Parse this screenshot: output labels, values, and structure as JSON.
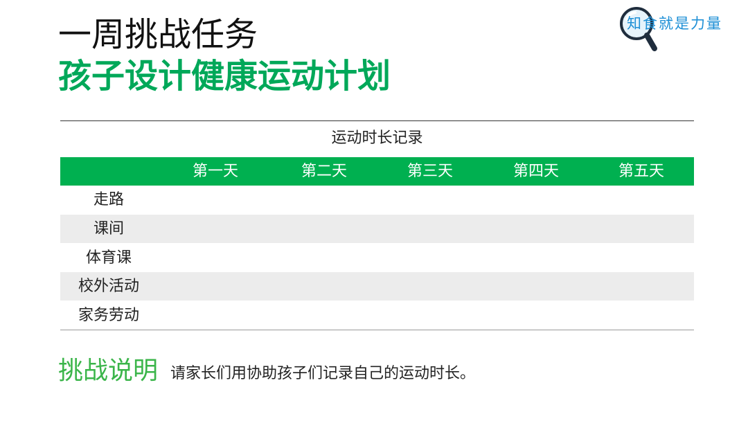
{
  "header": {
    "title_line1": "一周挑战任务",
    "title_line2": "孩子设计健康运动计划"
  },
  "logo": {
    "text": "知食就是力量",
    "icon": "magnifier-icon"
  },
  "table": {
    "caption": "运动时长记录",
    "columns": [
      "第一天",
      "第二天",
      "第三天",
      "第四天",
      "第五天"
    ],
    "rows": [
      {
        "label": "走路",
        "shaded": false
      },
      {
        "label": "课间",
        "shaded": true
      },
      {
        "label": "体育课",
        "shaded": false
      },
      {
        "label": "校外活动",
        "shaded": true
      },
      {
        "label": "家务劳动",
        "shaded": false
      }
    ]
  },
  "challenge": {
    "label": "挑战说明",
    "text": "请家长们用协助孩子们记录自己的运动时长。"
  },
  "colors": {
    "accent_green": "#00b050",
    "title_green": "#00a859",
    "row_shade": "#ececec",
    "logo_blue": "#1d8fd6"
  }
}
